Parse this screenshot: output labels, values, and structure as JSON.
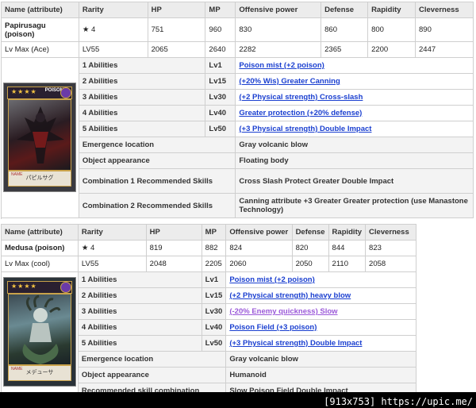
{
  "table1": {
    "header": [
      "Name (attribute)",
      "Rarity",
      "HP",
      "MP",
      "Offensive power",
      "Defense",
      "Rapidity",
      "Cleverness"
    ],
    "name": "Papirusagu\n(poison)",
    "rarity": "★ 4",
    "stats": [
      "751",
      "960",
      "830",
      "860",
      "800",
      "890"
    ],
    "lvmax_label": "Lv Max (Ace)",
    "lvmax_rarity": "LV55",
    "lvmax_stats": [
      "2065",
      "2640",
      "2282",
      "2365",
      "2200",
      "2447"
    ],
    "abilities": [
      {
        "label": "1 Abilities",
        "lv": "Lv1",
        "name": "Poison mist (+2 poison)"
      },
      {
        "label": "2 Abilities",
        "lv": "Lv15",
        "name": "(+20% Wis) Greater Canning"
      },
      {
        "label": "3 Abilities",
        "lv": "Lv30",
        "name": "(+2 Physical strength) Cross-slash"
      },
      {
        "label": "4 Abilities",
        "lv": "Lv40",
        "name": "Greater protection (+20% defense)"
      },
      {
        "label": "5 Abilities",
        "lv": "Lv50",
        "name": "(+3 Physical strength) Double Impact"
      }
    ],
    "rows": [
      {
        "label": "Emergence location",
        "value": "Gray volcanic blow"
      },
      {
        "label": "Object appearance",
        "value": "Floating body"
      },
      {
        "label": "Combination 1 Recommended Skills",
        "value": "Cross Slash Protect Greater Double Impact"
      },
      {
        "label": "Combination 2 Recommended Skills",
        "value": "Canning attribute +3 Greater Greater protection (use Manastone Technology)"
      }
    ],
    "card": {
      "stars": "★★★★",
      "element": "POISON",
      "name": "パピルサグ",
      "name_tag": "NAME"
    }
  },
  "table2": {
    "header": [
      "Name (attribute)",
      "Rarity",
      "HP",
      "MP",
      "Offensive power",
      "Defense",
      "Rapidity",
      "Cleverness"
    ],
    "name": "Medusa (poison)",
    "rarity": "★ 4",
    "stats": [
      "819",
      "882",
      "824",
      "820",
      "844",
      "823"
    ],
    "lvmax_label": "Lv Max (cool)",
    "lvmax_rarity": "LV55",
    "lvmax_stats": [
      "2048",
      "2205",
      "2060",
      "2050",
      "2110",
      "2058"
    ],
    "abilities": [
      {
        "label": "1 Abilities",
        "lv": "Lv1",
        "name": "Poison mist (+2 poison)"
      },
      {
        "label": "2 Abilities",
        "lv": "Lv15",
        "name": "(+2 Physical strength) heavy blow"
      },
      {
        "label": "3 Abilities",
        "lv": "Lv30",
        "name": "(-20% Enemy quickness) Slow"
      },
      {
        "label": "4 Abilities",
        "lv": "Lv40",
        "name": "Poison Field (+3 poison)"
      },
      {
        "label": "5 Abilities",
        "lv": "Lv50",
        "name": "(+3 Physical strength) Double Impact"
      }
    ],
    "rows": [
      {
        "label": "Emergence location",
        "value": "Gray volcanic blow"
      },
      {
        "label": "Object appearance",
        "value": "Humanoid"
      },
      {
        "label": "Recommended skill combination",
        "value": "Slow Poison Field Double Impact"
      }
    ],
    "card": {
      "stars": "★★★★",
      "name": "メデューサ",
      "name_tag": "NAME"
    }
  },
  "footer": "[913x753] https://upic.me/"
}
